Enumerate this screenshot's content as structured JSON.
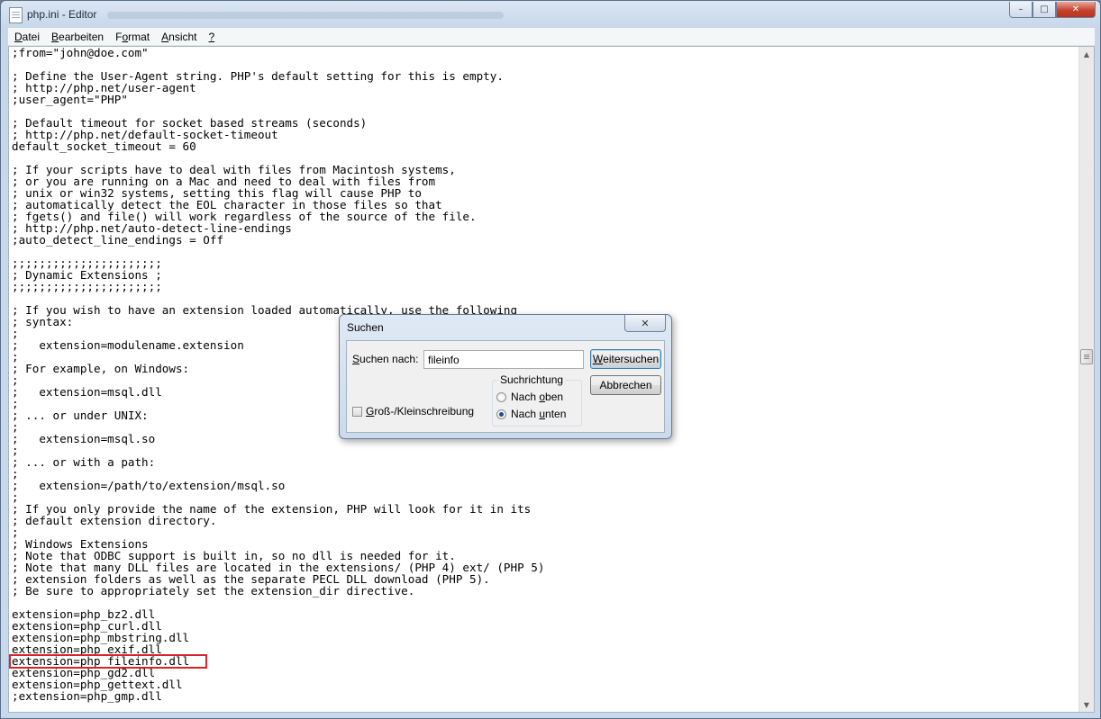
{
  "window": {
    "title": "php.ini - Editor",
    "controls": {
      "minimize": "–",
      "maximize": "□",
      "close": "✕"
    }
  },
  "menu": [
    {
      "pre": "",
      "key": "D",
      "post": "atei"
    },
    {
      "pre": "",
      "key": "B",
      "post": "earbeiten"
    },
    {
      "pre": "F",
      "key": "o",
      "post": "rmat"
    },
    {
      "pre": "",
      "key": "A",
      "post": "nsicht"
    },
    {
      "pre": "",
      "key": "?",
      "post": ""
    }
  ],
  "editor": {
    "content": ";from=\"john@doe.com\"\n\n; Define the User-Agent string. PHP's default setting for this is empty.\n; http://php.net/user-agent\n;user_agent=\"PHP\"\n\n; Default timeout for socket based streams (seconds)\n; http://php.net/default-socket-timeout\ndefault_socket_timeout = 60\n\n; If your scripts have to deal with files from Macintosh systems,\n; or you are running on a Mac and need to deal with files from\n; unix or win32 systems, setting this flag will cause PHP to\n; automatically detect the EOL character in those files so that\n; fgets() and file() will work regardless of the source of the file.\n; http://php.net/auto-detect-line-endings\n;auto_detect_line_endings = Off\n\n;;;;;;;;;;;;;;;;;;;;;;\n; Dynamic Extensions ;\n;;;;;;;;;;;;;;;;;;;;;;\n\n; If you wish to have an extension loaded automatically, use the following\n; syntax:\n;\n;   extension=modulename.extension\n;\n; For example, on Windows:\n;\n;   extension=msql.dll\n;\n; ... or under UNIX:\n;\n;   extension=msql.so\n;\n; ... or with a path:\n;\n;   extension=/path/to/extension/msql.so\n;\n; If you only provide the name of the extension, PHP will look for it in its\n; default extension directory.\n;\n; Windows Extensions\n; Note that ODBC support is built in, so no dll is needed for it.\n; Note that many DLL files are located in the extensions/ (PHP 4) ext/ (PHP 5)\n; extension folders as well as the separate PECL DLL download (PHP 5).\n; Be sure to appropriately set the extension_dir directive.\n\nextension=php_bz2.dll\nextension=php_curl.dll\nextension=php_mbstring.dll\nextension=php_exif.dll\nextension=php_fileinfo.dll\nextension=php_gd2.dll\nextension=php_gettext.dll\n;extension=php_gmp.dll",
    "highlight_color": "#d8232a"
  },
  "scrollbar": {
    "up": "▲",
    "down": "▼"
  },
  "find_dialog": {
    "title": "Suchen",
    "close": "✕",
    "find_label_pre": "",
    "find_label_key": "S",
    "find_label_post": "uchen nach:",
    "find_value": "fileinfo",
    "find_next": {
      "pre": "",
      "key": "W",
      "post": "eitersuchen"
    },
    "cancel": "Abbrechen",
    "direction_legend": "Suchrichtung",
    "direction_up": {
      "pre": "Nach ",
      "key": "o",
      "post": "ben"
    },
    "direction_down": {
      "pre": "Nach ",
      "key": "u",
      "post": "nten"
    },
    "selected_direction": "down",
    "match_case": {
      "pre": "",
      "key": "G",
      "post": "roß-/Kleinschreibung"
    },
    "match_case_checked": false
  }
}
